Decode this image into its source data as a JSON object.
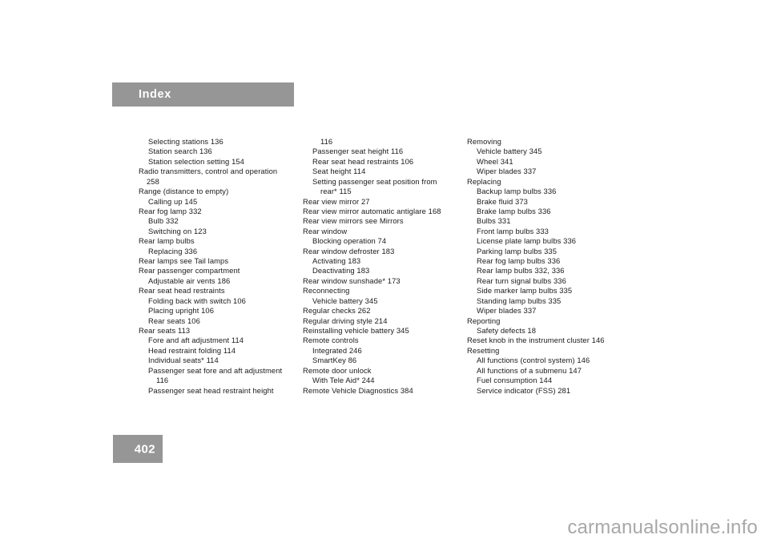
{
  "header": {
    "title": "Index",
    "bar_color": "#969696",
    "text_color": "#ffffff"
  },
  "page": {
    "number": "402",
    "block_color": "#969696",
    "text_color": "#ffffff"
  },
  "watermark": {
    "text": "carmanualsonline.info",
    "color": "#a8a8a8"
  },
  "columns": [
    {
      "id": "column-1",
      "entries": [
        {
          "level": 1,
          "text": "Selecting stations 136"
        },
        {
          "level": 1,
          "text": "Station search 136"
        },
        {
          "level": 1,
          "text": "Station selection setting 154"
        },
        {
          "level": 0,
          "text": "Radio transmitters, control and operation"
        },
        {
          "level": "0w",
          "text": "258"
        },
        {
          "level": 0,
          "text": "Range (distance to empty)"
        },
        {
          "level": 1,
          "text": "Calling up 145"
        },
        {
          "level": 0,
          "text": "Rear fog lamp 332"
        },
        {
          "level": 1,
          "text": "Bulb 332"
        },
        {
          "level": 1,
          "text": "Switching on 123"
        },
        {
          "level": 0,
          "text": "Rear lamp bulbs"
        },
        {
          "level": 1,
          "text": "Replacing 336"
        },
        {
          "level": 0,
          "text": "Rear lamps see Tail lamps"
        },
        {
          "level": 0,
          "text": "Rear passenger compartment"
        },
        {
          "level": 1,
          "text": "Adjustable air vents 186"
        },
        {
          "level": 0,
          "text": "Rear seat head restraints"
        },
        {
          "level": 1,
          "text": "Folding back with switch 106"
        },
        {
          "level": 1,
          "text": "Placing upright 106"
        },
        {
          "level": 1,
          "text": "Rear seats 106"
        },
        {
          "level": 0,
          "text": "Rear seats 113"
        },
        {
          "level": 1,
          "text": "Fore and aft adjustment 114"
        },
        {
          "level": 1,
          "text": "Head restraint folding 114"
        },
        {
          "level": 1,
          "text": "Individual seats* 114"
        },
        {
          "level": 1,
          "text": "Passenger seat fore and aft adjustment"
        },
        {
          "level": "1w",
          "text": "116"
        },
        {
          "level": 1,
          "text": "Passenger seat head restraint height"
        }
      ]
    },
    {
      "id": "column-2",
      "entries": [
        {
          "level": "1w",
          "text": "116"
        },
        {
          "level": 1,
          "text": "Passenger seat height 116"
        },
        {
          "level": 1,
          "text": "Rear seat head restraints 106"
        },
        {
          "level": 1,
          "text": "Seat height 114"
        },
        {
          "level": 1,
          "text": "Setting passenger seat position from"
        },
        {
          "level": "1w",
          "text": "rear* 115"
        },
        {
          "level": 0,
          "text": "Rear view mirror 27"
        },
        {
          "level": 0,
          "text": "Rear view mirror automatic antiglare 168"
        },
        {
          "level": 0,
          "text": "Rear view mirrors see Mirrors"
        },
        {
          "level": 0,
          "text": "Rear window"
        },
        {
          "level": 1,
          "text": "Blocking operation 74"
        },
        {
          "level": 0,
          "text": "Rear window defroster 183"
        },
        {
          "level": 1,
          "text": "Activating 183"
        },
        {
          "level": 1,
          "text": "Deactivating 183"
        },
        {
          "level": 0,
          "text": "Rear window sunshade* 173"
        },
        {
          "level": 0,
          "text": "Reconnecting"
        },
        {
          "level": 1,
          "text": "Vehicle battery 345"
        },
        {
          "level": 0,
          "text": "Regular checks 262"
        },
        {
          "level": 0,
          "text": "Regular driving style 214"
        },
        {
          "level": 0,
          "text": "Reinstalling vehicle battery 345"
        },
        {
          "level": 0,
          "text": "Remote controls"
        },
        {
          "level": 1,
          "text": "Integrated 246"
        },
        {
          "level": 1,
          "text": "SmartKey 86"
        },
        {
          "level": 0,
          "text": "Remote door unlock"
        },
        {
          "level": 1,
          "text": "With Tele Aid* 244"
        },
        {
          "level": 0,
          "text": "Remote Vehicle Diagnostics 384"
        }
      ]
    },
    {
      "id": "column-3",
      "entries": [
        {
          "level": 0,
          "text": "Removing"
        },
        {
          "level": 1,
          "text": "Vehicle battery 345"
        },
        {
          "level": 1,
          "text": "Wheel 341"
        },
        {
          "level": 1,
          "text": "Wiper blades 337"
        },
        {
          "level": 0,
          "text": "Replacing"
        },
        {
          "level": 1,
          "text": "Backup lamp bulbs 336"
        },
        {
          "level": 1,
          "text": "Brake fluid 373"
        },
        {
          "level": 1,
          "text": "Brake lamp bulbs 336"
        },
        {
          "level": 1,
          "text": "Bulbs 331"
        },
        {
          "level": 1,
          "text": "Front lamp bulbs 333"
        },
        {
          "level": 1,
          "text": "License plate lamp bulbs 336"
        },
        {
          "level": 1,
          "text": "Parking lamp bulbs 335"
        },
        {
          "level": 1,
          "text": "Rear fog lamp bulbs 336"
        },
        {
          "level": 1,
          "text": "Rear lamp bulbs 332, 336"
        },
        {
          "level": 1,
          "text": "Rear turn signal bulbs 336"
        },
        {
          "level": 1,
          "text": "Side marker lamp bulbs 335"
        },
        {
          "level": 1,
          "text": "Standing lamp bulbs 335"
        },
        {
          "level": 1,
          "text": "Wiper blades 337"
        },
        {
          "level": 0,
          "text": "Reporting"
        },
        {
          "level": 1,
          "text": "Safety defects 18"
        },
        {
          "level": 0,
          "text": "Reset knob in the instrument cluster 146"
        },
        {
          "level": 0,
          "text": "Resetting"
        },
        {
          "level": 1,
          "text": "All functions (control system) 146"
        },
        {
          "level": 1,
          "text": "All functions of a submenu 147"
        },
        {
          "level": 1,
          "text": "Fuel consumption 144"
        },
        {
          "level": 1,
          "text": "Service indicator (FSS) 281"
        }
      ]
    }
  ]
}
